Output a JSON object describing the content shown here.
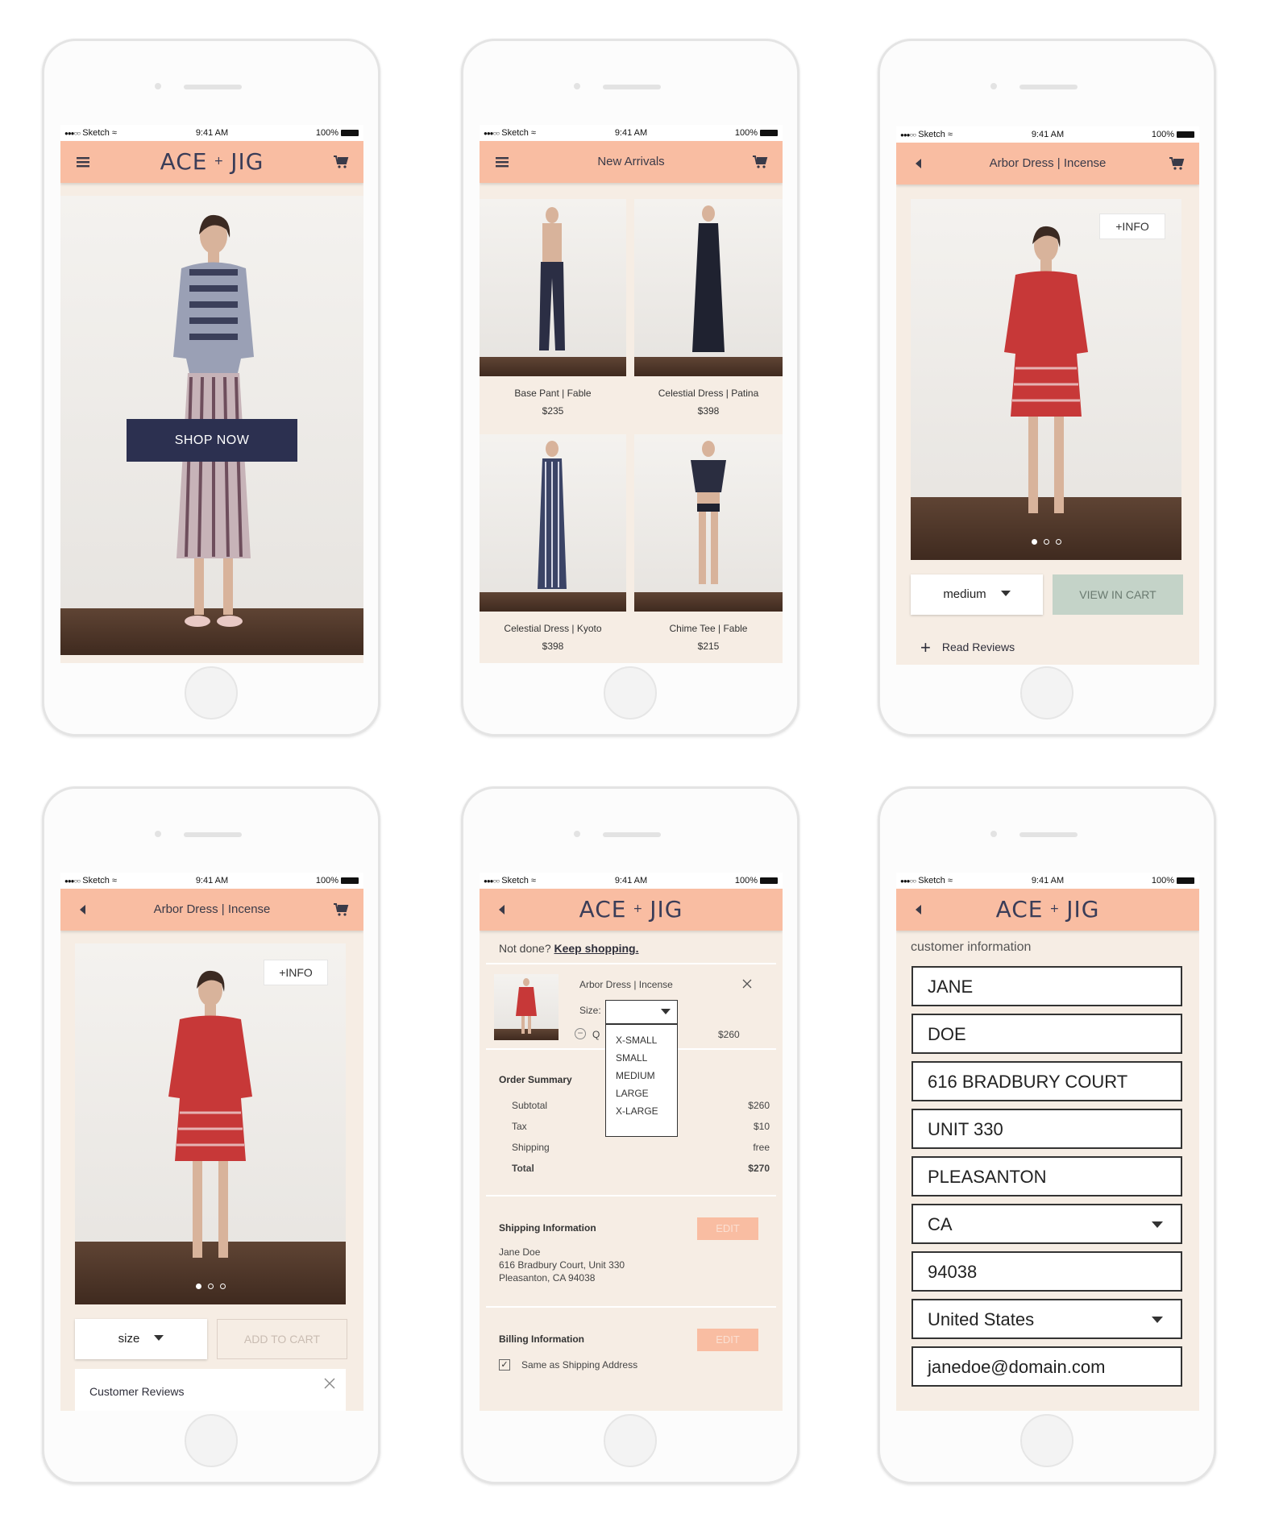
{
  "status": {
    "carrier": "Sketch",
    "time": "9:41 AM",
    "battery": "100%"
  },
  "screen1": {
    "logo_left": "ACE",
    "logo_plus": "+",
    "logo_right": "JIG",
    "shop_now": "SHOP NOW"
  },
  "screen2": {
    "title": "New Arrivals",
    "products": [
      {
        "name": "Base Pant | Fable",
        "price": "$235"
      },
      {
        "name": "Celestial Dress | Patina",
        "price": "$398"
      },
      {
        "name": "Celestial Dress | Kyoto",
        "price": "$398"
      },
      {
        "name": "Chime Tee | Fable",
        "price": "$215"
      }
    ]
  },
  "screen3": {
    "title": "Arbor Dress | Incense",
    "info": "+INFO",
    "size_value": "medium",
    "view_in_cart": "VIEW IN CART",
    "read_reviews": "Read Reviews"
  },
  "screen4": {
    "title": "Arbor Dress | Incense",
    "info": "+INFO",
    "size_value": "size",
    "add_to_cart": "ADD TO CART",
    "reviews_title": "Customer Reviews"
  },
  "screen5": {
    "not_done": "Not done?",
    "keep_shopping": "Keep shopping.",
    "item_name": "Arbor Dress | Incense",
    "size_label": "Size:",
    "qty_label": "Q",
    "item_price": "$260",
    "size_options": [
      "X-SMALL",
      "SMALL",
      "MEDIUM",
      "LARGE",
      "X-LARGE"
    ],
    "order_summary": "Order Summary",
    "subtotal_label": "Subtotal",
    "subtotal": "$260",
    "tax_label": "Tax",
    "tax": "$10",
    "shipping_label": "Shipping",
    "shipping": "free",
    "total_label": "Total",
    "total": "$270",
    "shipping_info_title": "Shipping Information",
    "edit": "EDIT",
    "address_name": "Jane Doe",
    "address_line": "616 Bradbury Court, Unit 330",
    "address_city": "Pleasanton, CA 94038",
    "billing_title": "Billing Information",
    "same_as_shipping": "Same as Shipping Address"
  },
  "screen6": {
    "section_title": "customer information",
    "first_name": "JANE",
    "last_name": "DOE",
    "address": "616 BRADBURY COURT",
    "unit": "UNIT 330",
    "city": "PLEASANTON",
    "state": "CA",
    "zip": "94038",
    "country": "United States",
    "email": "janedoe@domain.com"
  },
  "colors": {
    "nav": "#f9bda2",
    "background": "#f6ede4",
    "button_dark": "#2c3050",
    "button_green": "#c4d3c8"
  }
}
